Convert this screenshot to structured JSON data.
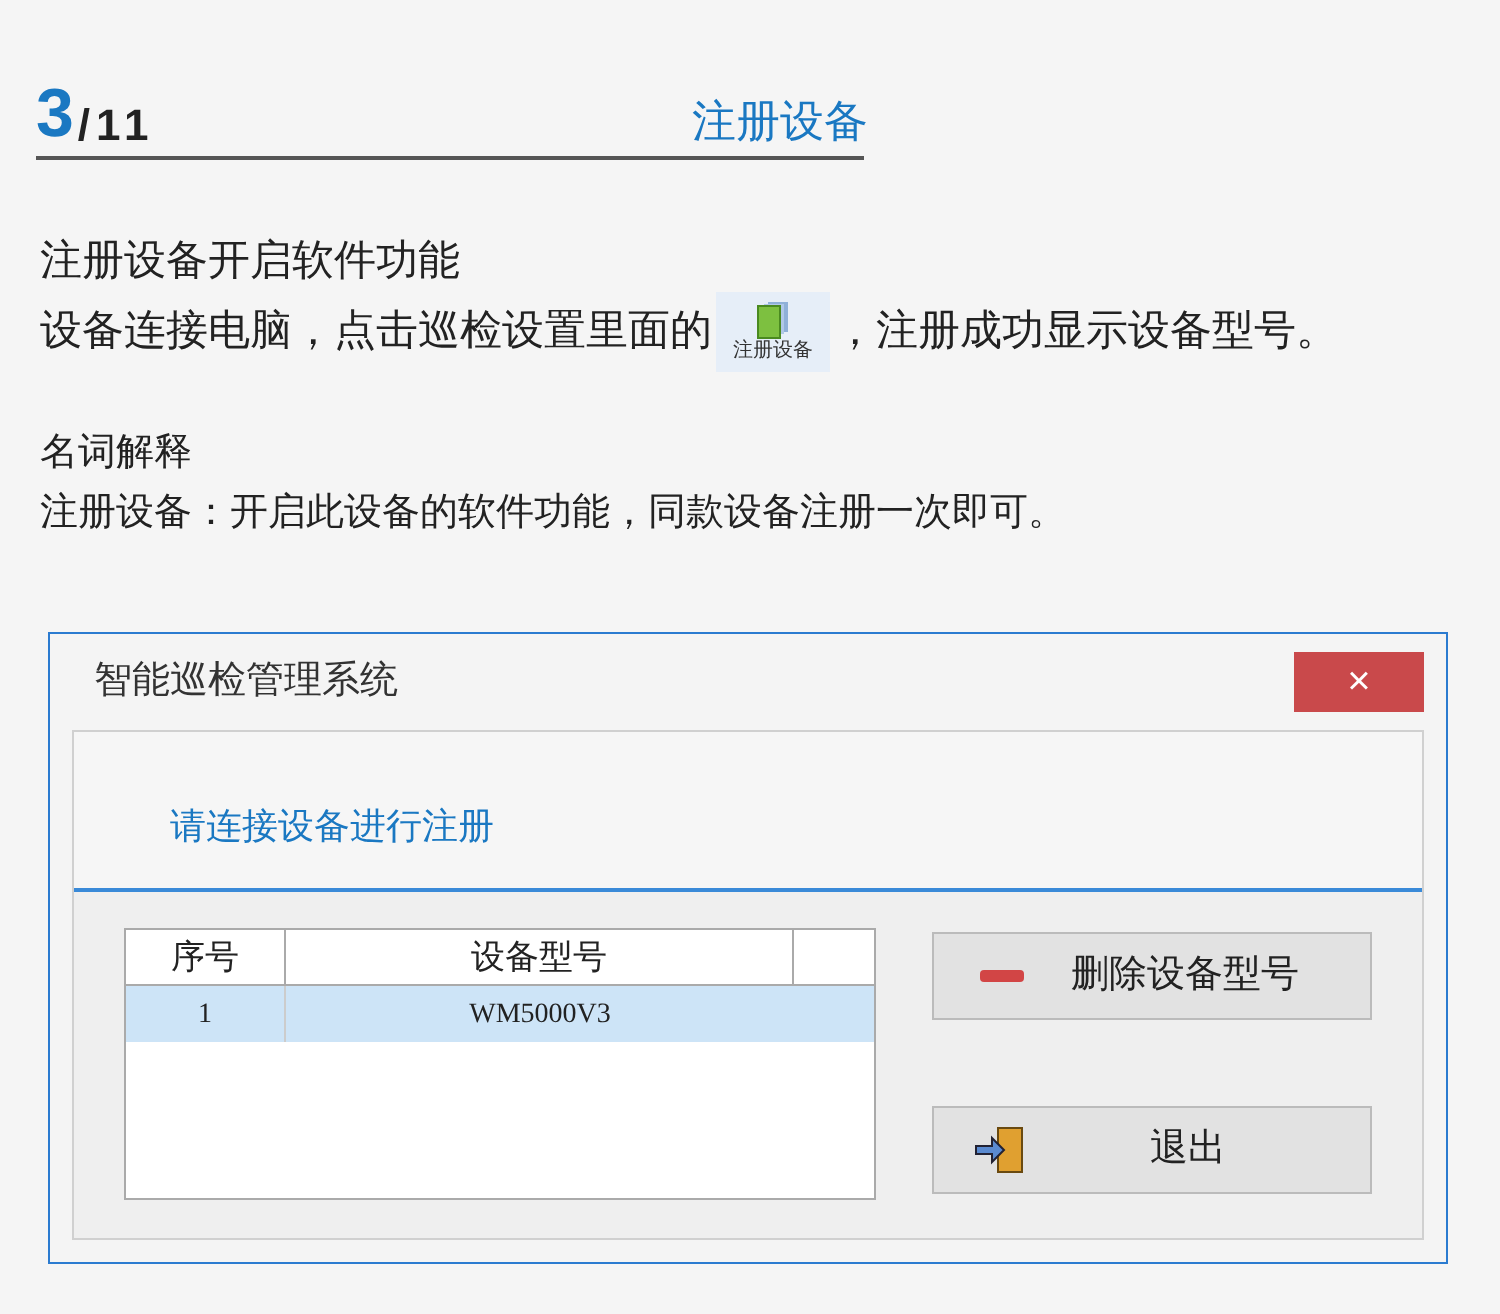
{
  "header": {
    "page_current": "3",
    "page_total": "/11",
    "title": "注册设备"
  },
  "intro": {
    "line_1": "注册设备开启软件功能",
    "line_2_before": "设备连接电脑，点击巡检设置里面的",
    "inline_button": {
      "label": "注册设备"
    },
    "line_2_after": "，注册成功显示设备型号。"
  },
  "glossary": {
    "heading": "名词解释",
    "text": "注册设备：开启此设备的软件功能，同款设备注册一次即可。"
  },
  "dialog": {
    "title": "智能巡检管理系统",
    "close": "×",
    "prompt": "请连接设备进行注册",
    "table": {
      "columns": [
        "序号",
        "设备型号"
      ],
      "rows": [
        {
          "cells": [
            "1",
            "WM5000V3"
          ],
          "selected": true
        }
      ]
    },
    "buttons": [
      {
        "kind": "delete",
        "label": "删除设备型号"
      },
      {
        "kind": "exit",
        "label": "退出"
      }
    ]
  }
}
